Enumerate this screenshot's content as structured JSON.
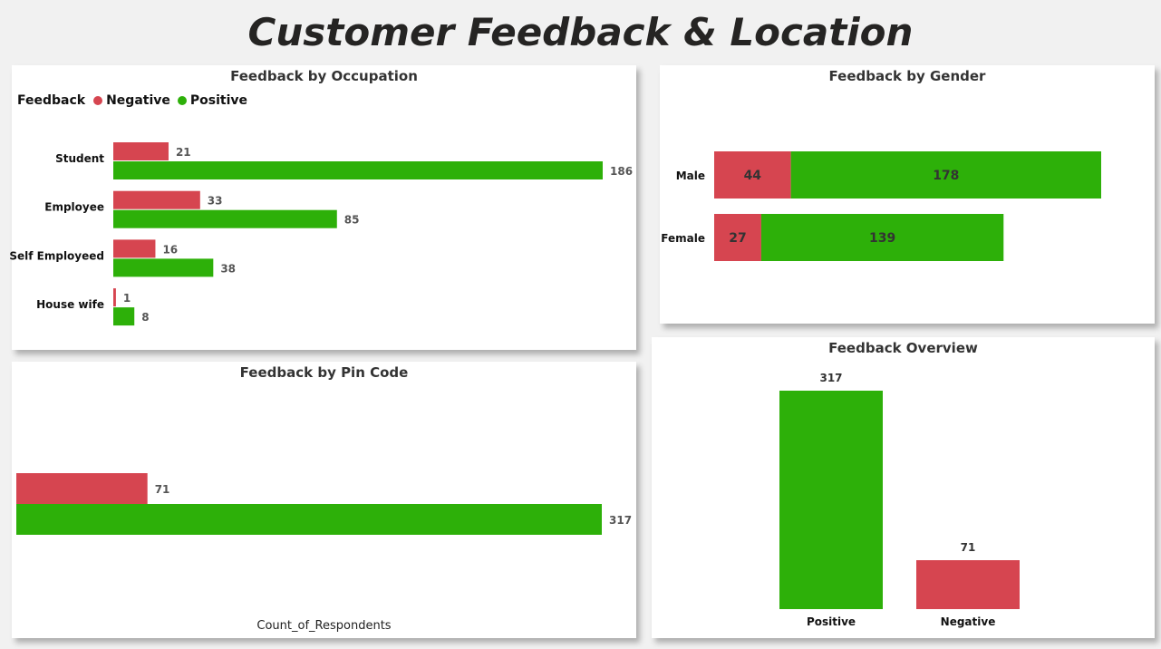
{
  "page": {
    "title": "Customer Feedback & Location"
  },
  "colors": {
    "negative": "#d64550",
    "positive": "#2db009",
    "text_dark": "#252423",
    "label": "#555555"
  },
  "chart_data": [
    {
      "id": "occupation",
      "type": "bar",
      "orientation": "horizontal",
      "title": "Feedback by Occupation",
      "legend": {
        "title": "Feedback",
        "items": [
          "Negative",
          "Positive"
        ],
        "position": "top-left"
      },
      "categories": [
        "Student",
        "Employee",
        "Self Employeed",
        "House wife"
      ],
      "series": [
        {
          "name": "Negative",
          "values": [
            21,
            33,
            16,
            1
          ]
        },
        {
          "name": "Positive",
          "values": [
            186,
            85,
            38,
            8
          ]
        }
      ]
    },
    {
      "id": "gender",
      "type": "bar",
      "orientation": "horizontal",
      "stacked": true,
      "title": "Feedback by Gender",
      "categories": [
        "Male",
        "Female"
      ],
      "series": [
        {
          "name": "Negative",
          "values": [
            44,
            27
          ]
        },
        {
          "name": "Positive",
          "values": [
            178,
            139
          ]
        }
      ]
    },
    {
      "id": "pincode",
      "type": "bar",
      "orientation": "horizontal",
      "title": "Feedback by Pin Code",
      "xlabel": "Count_of_Respondents",
      "categories": [
        ""
      ],
      "series": [
        {
          "name": "Negative",
          "values": [
            71
          ]
        },
        {
          "name": "Positive",
          "values": [
            317
          ]
        }
      ]
    },
    {
      "id": "overview",
      "type": "bar",
      "orientation": "vertical",
      "title": "Feedback Overview",
      "categories": [
        "Positive",
        "Negative"
      ],
      "values": [
        317,
        71
      ],
      "colors": [
        "#2db009",
        "#d64550"
      ]
    }
  ]
}
